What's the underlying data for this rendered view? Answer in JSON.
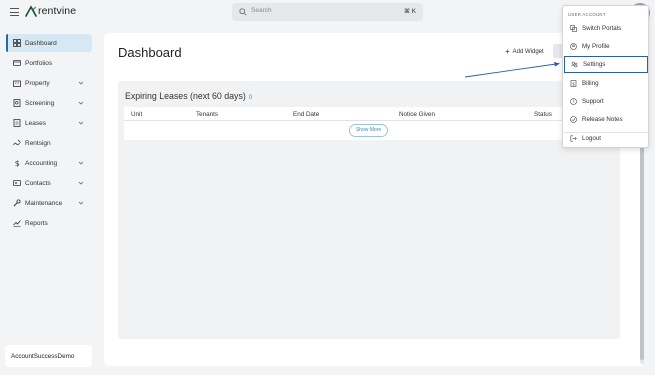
{
  "header": {
    "logo_text": "rentvine",
    "search_placeholder": "Search",
    "search_shortcut": "⌘ K"
  },
  "sidebar": {
    "items": [
      {
        "label": "Dashboard",
        "icon": "dashboard-icon",
        "active": true
      },
      {
        "label": "Portfolios",
        "icon": "portfolio-icon"
      },
      {
        "label": "Property",
        "icon": "property-icon",
        "expandable": true
      },
      {
        "label": "Screening",
        "icon": "screening-icon",
        "expandable": true
      },
      {
        "label": "Leases",
        "icon": "leases-icon",
        "expandable": true
      },
      {
        "label": "Rentsign",
        "icon": "rentsign-icon"
      },
      {
        "label": "Accounting",
        "icon": "dollar-icon",
        "expandable": true
      },
      {
        "label": "Contacts",
        "icon": "contacts-icon",
        "expandable": true
      },
      {
        "label": "Maintenance",
        "icon": "wrench-icon",
        "expandable": true
      },
      {
        "label": "Reports",
        "icon": "reports-icon"
      }
    ],
    "account_name": "AccountSuccessDemo"
  },
  "main": {
    "title": "Dashboard",
    "add_widget_label": "Add Widget",
    "panel": {
      "title": "Expiring Leases (next 60 days)",
      "count": "0",
      "columns": [
        "Unit",
        "Tenants",
        "End Date",
        "Notice Given",
        "Status"
      ],
      "show_more_label": "Show More"
    }
  },
  "dropdown": {
    "header": "USER ACCOUNT",
    "items": [
      {
        "label": "Switch Portals",
        "icon": "switch-portals-icon"
      },
      {
        "label": "My Profile",
        "icon": "profile-icon"
      },
      {
        "label": "Settings",
        "icon": "settings-icon",
        "highlighted": true
      },
      {
        "label": "Billing",
        "icon": "billing-icon"
      },
      {
        "label": "Support",
        "icon": "support-icon"
      },
      {
        "label": "Release Notes",
        "icon": "release-notes-icon"
      },
      {
        "label": "Logout",
        "icon": "logout-icon"
      }
    ]
  },
  "colors": {
    "accent": "#1f6f9a",
    "active_bg": "#d6e8f3",
    "link": "#3b8bc2",
    "highlight_border": "#2a5db0"
  }
}
